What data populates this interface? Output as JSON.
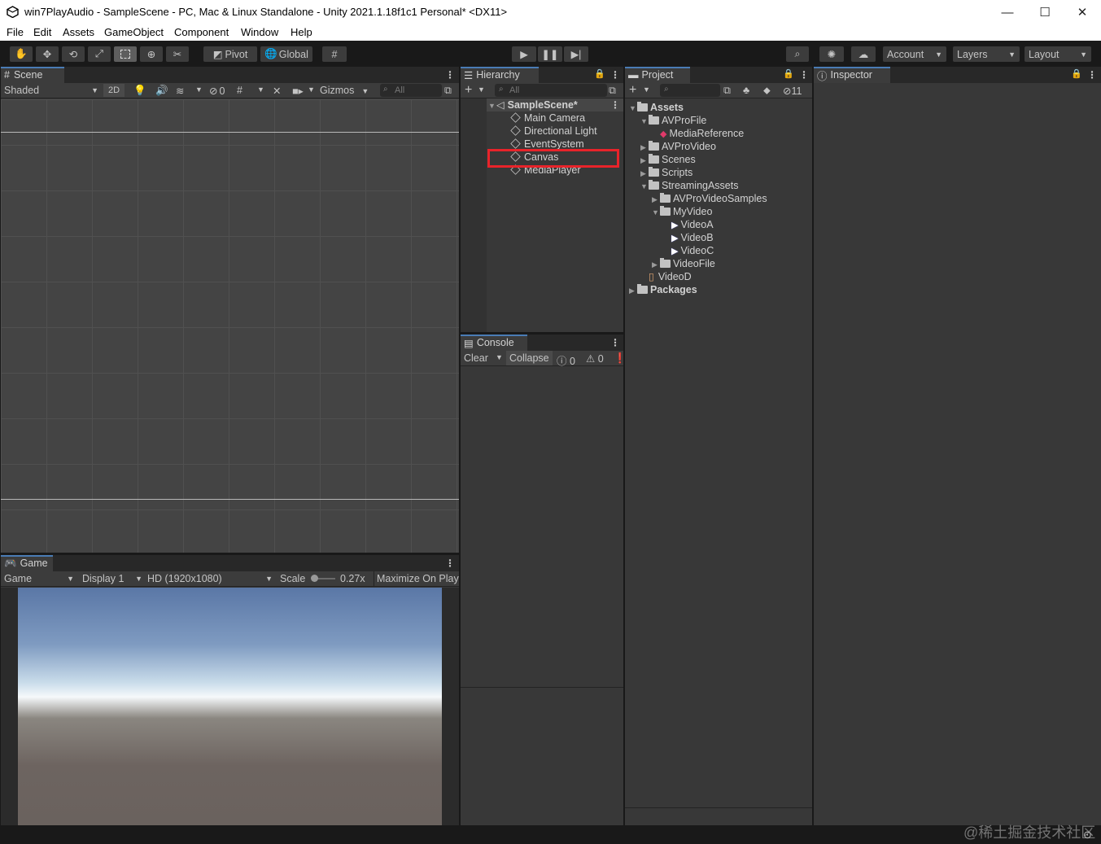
{
  "window": {
    "title": "win7PlayAudio - SampleScene - PC, Mac & Linux Standalone - Unity 2021.1.18f1c1 Personal* <DX11>",
    "minimize": "—",
    "maximize": "☐",
    "close": "✕"
  },
  "menu": [
    "File",
    "Edit",
    "Assets",
    "GameObject",
    "Component",
    "Window",
    "Help"
  ],
  "toolbar": {
    "pivot": "Pivot",
    "global": "Global",
    "account": "Account",
    "layers": "Layers",
    "layout": "Layout"
  },
  "scene": {
    "tab": "Scene",
    "shading": "Shaded",
    "mode2d": "2D",
    "hidden_count": "0",
    "gizmos": "Gizmos",
    "search_placeholder": "All"
  },
  "game": {
    "tab": "Game",
    "view": "Game",
    "display": "Display 1",
    "resolution": "HD (1920x1080)",
    "scale_label": "Scale",
    "scale_value": "0.27x",
    "maximize": "Maximize On Play"
  },
  "hierarchy": {
    "tab": "Hierarchy",
    "search_placeholder": "All",
    "scene": "SampleScene*",
    "items": [
      "Main Camera",
      "Directional Light",
      "EventSystem",
      "Canvas",
      "MediaPlayer"
    ],
    "highlighted": "Canvas",
    "highlight_color": "#e8232a"
  },
  "console": {
    "tab": "Console",
    "clear": "Clear",
    "collapse": "Collapse",
    "info_count": "0",
    "warn_count": "0"
  },
  "project": {
    "tab": "Project",
    "hidden_count": "11",
    "tree": [
      {
        "label": "Assets",
        "depth": 0,
        "open": true,
        "icon": "folder",
        "bold": true
      },
      {
        "label": "AVProFile",
        "depth": 1,
        "open": true,
        "icon": "folder"
      },
      {
        "label": "MediaReference",
        "depth": 2,
        "icon": "media-reference"
      },
      {
        "label": "AVProVideo",
        "depth": 1,
        "open": false,
        "icon": "folder"
      },
      {
        "label": "Scenes",
        "depth": 1,
        "open": false,
        "icon": "folder"
      },
      {
        "label": "Scripts",
        "depth": 1,
        "open": false,
        "icon": "folder"
      },
      {
        "label": "StreamingAssets",
        "depth": 1,
        "open": true,
        "icon": "folder"
      },
      {
        "label": "AVProVideoSamples",
        "depth": 2,
        "open": false,
        "icon": "folder"
      },
      {
        "label": "MyVideo",
        "depth": 2,
        "open": true,
        "icon": "folder"
      },
      {
        "label": "VideoA",
        "depth": 3,
        "icon": "video"
      },
      {
        "label": "VideoB",
        "depth": 3,
        "icon": "video"
      },
      {
        "label": "VideoC",
        "depth": 3,
        "icon": "video"
      },
      {
        "label": "VideoFile",
        "depth": 2,
        "open": false,
        "icon": "folder"
      },
      {
        "label": "VideoD",
        "depth": 1,
        "icon": "video-clip"
      },
      {
        "label": "Packages",
        "depth": 0,
        "open": false,
        "icon": "folder",
        "bold": true
      }
    ]
  },
  "inspector": {
    "tab": "Inspector"
  },
  "watermark": "@稀土掘金技术社区"
}
